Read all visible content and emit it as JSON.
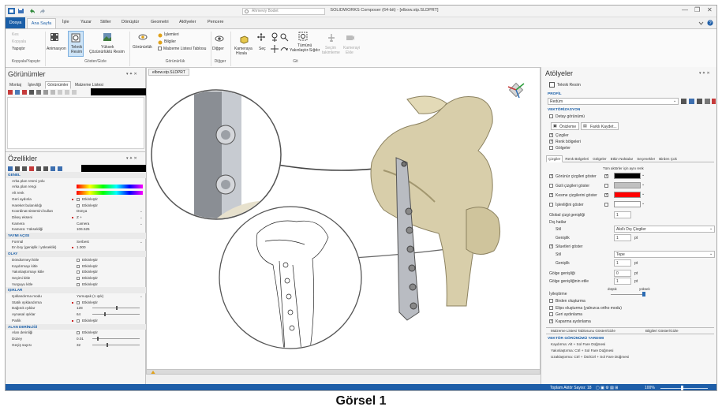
{
  "window": {
    "title": "SOLIDWORKS Composer (64-bit) - [elbow.stp.SLDPRT]",
    "search_placeholder": "Ahmeviy Bodet",
    "minimize": "—",
    "restore": "❐",
    "close": "✕"
  },
  "menu": {
    "file": "Dosya",
    "tabs": [
      "Ana Sayfa",
      "İşle",
      "Yazar",
      "Stiller",
      "Dönüştür",
      "Geometri",
      "Atölyeler",
      "Pencere"
    ],
    "active_tab": "Ana Sayfa"
  },
  "ribbon": {
    "clipboard": {
      "cut": "Kes",
      "copy": "Kopyala",
      "paste": "Yapıştır",
      "group": "Kopyala/Yapıştır"
    },
    "view": {
      "animation": "Animasyon",
      "technical": "Teknik",
      "technical2": "Resim",
      "hires": "Yüksek",
      "hires2": "Çözünürlüklü Resim",
      "group": "Göster/Gizle"
    },
    "visibility": {
      "show": "Görünürlük",
      "markers": "İşlemleri",
      "info": "Bilgiler",
      "bom_table": "Malzeme Listesi Tablosu",
      "group": "Görünürlük"
    },
    "other": {
      "label": "Diğger",
      "group": "Diğger"
    },
    "camera": {
      "camera": "Kameraya",
      "align": "Hizala",
      "select": "Seç",
      "fit": "Tümünü",
      "fit2": "Yakınlaştır-Sığdır",
      "group": "Git"
    },
    "flight": {
      "label": "Seçim",
      "label2": "takimleme",
      "label3": "Kamerayi",
      "label4": "Ekle"
    }
  },
  "left_top": {
    "title": "Görünümler",
    "tabs": [
      "Montaj",
      "İşlevliği",
      "Görünümler",
      "Malzeme Listesi"
    ],
    "active_tab": "Görünümler"
  },
  "properties": {
    "title": "Özellikler",
    "rows": [
      {
        "type": "section",
        "label": "GENEL"
      },
      {
        "label": "Arka plan resmi yolu",
        "value": ""
      },
      {
        "label": "Arka plan rengi",
        "value": "",
        "gradient": true
      },
      {
        "label": "Alt renk",
        "value": "",
        "gradient": true
      },
      {
        "label": "Geri aydınla",
        "value": "Etkinleştir",
        "check": true,
        "dot": true
      },
      {
        "label": "Hareket bulanıklığı",
        "value": "Etkinleştir",
        "check": true
      },
      {
        "label": "Koordinat sistemini kullan",
        "value": "Dünya",
        "dropdown": true
      },
      {
        "label": "Dikey ekseni",
        "value": "Z +",
        "dropdown": true,
        "dot": true
      },
      {
        "label": "Kamera",
        "value": "Camera",
        "dropdown": true
      },
      {
        "label": "Kamera: Yüksekliği",
        "value": "106.525"
      },
      {
        "type": "section",
        "label": "YAYMI AÇISI"
      },
      {
        "label": "Formül",
        "value": "Serbest",
        "dropdown": true
      },
      {
        "label": "En boy (genişlik / yükseklik)",
        "value": "1.000",
        "dot": true
      },
      {
        "type": "section",
        "label": "OLAY"
      },
      {
        "label": "Döndürmeyi kitle",
        "value": "Etkinleştir",
        "check": true
      },
      {
        "label": "Kaydırmayı kitle",
        "value": "Etkinleştir",
        "check": true
      },
      {
        "label": "Yakınlaştırmayı kitle",
        "value": "Etkinleştir",
        "check": true
      },
      {
        "label": "Seçimi kitle",
        "value": "Etkinleştir",
        "check": true
      },
      {
        "label": "Vurguyu kitle",
        "value": "Etkinleştir",
        "check": true
      },
      {
        "type": "section",
        "label": "IŞIKLAR"
      },
      {
        "label": "Işıklandırma modu",
        "value": "Yumuşak (1 ışık)",
        "dropdown": true
      },
      {
        "label": "Statik ışıklandırma",
        "value": "Etkinleştir",
        "check": true,
        "dot": true
      },
      {
        "label": "Dağınık ışıklar",
        "value": "128",
        "slider": 0.5
      },
      {
        "label": "Aynasal ışıklar",
        "value": "64",
        "slider": 0.25
      },
      {
        "label": "Parlik",
        "value": "Etkinleştir",
        "check": true,
        "dot": true
      },
      {
        "type": "section",
        "label": "ALAN DERİNLİĞİ"
      },
      {
        "label": "Alan derinliği",
        "value": "Etkinleştir",
        "check": true
      },
      {
        "label": "Düzey",
        "value": "0.01",
        "slider": 0.1
      },
      {
        "label": "Geçiş sayısı",
        "value": "32",
        "slider": 0.3
      }
    ]
  },
  "viewport": {
    "tab": "elbow.stp.SLDPRT"
  },
  "workshop": {
    "title": "Atölyeler",
    "sub": "Teknik Resim",
    "profile_section": "PROFİL",
    "profile_value": "Redüm",
    "vectorize_section": "VEKTÖRİZASYON",
    "detail_view": "Detay görünümü",
    "preview": "Önizleme",
    "save_as": "Farklı Kaydet...",
    "lines": "Çizgiler",
    "color_areas": "Renk bölgeleri",
    "shadows": "Gölgeler",
    "tabs": [
      "Çizgiler",
      "Renk Bölgeleri",
      "Gölgeler",
      "Etkin Noktalar",
      "Seçenekler",
      "Birden Çok"
    ],
    "active_tab": "Çizgiler",
    "all_items_header": "Tüm aktörler için aynı renk",
    "line_rows": [
      {
        "label": "Görünür çizgileri göster",
        "color": "#000000",
        "checked": true
      },
      {
        "label": "Gizli çizgileri göster",
        "color": "#c0c0c0",
        "checked": false
      },
      {
        "label": "Kesme çizgilerini göster",
        "color": "#ff0000",
        "checked": true
      },
      {
        "label": "İşlevliğini göster",
        "color": "#ffffff",
        "checked": false
      }
    ],
    "global_width_label": "Global çizgi genişliği",
    "global_width_value": "1",
    "outlines": "Dış hatlar",
    "style_label": "Stil",
    "style_value": "Akıllı Dış Çizgiler",
    "width_label": "Genişlik",
    "width_value": "1",
    "width_unit": "pt",
    "silhouette": "Siluetleri göster",
    "style2_value": "Tepe",
    "width2_value": "1",
    "shadow_width_label": "Gölge genişliği",
    "shadow_width_value": "0",
    "shadow_angle_label": "Gölge genişliğinin etile",
    "shadow_angle_value": "1",
    "low": "düşük",
    "high": "yüksek",
    "smoothing": "İyileştirme",
    "opts": [
      {
        "label": "Birden oluşturma",
        "checked": false
      },
      {
        "label": "Elips oluşturma (yalnızca ortho modu)",
        "checked": false
      },
      {
        "label": "Geri aydınlama",
        "checked": false
      },
      {
        "label": "Kaparma aydınlama",
        "checked": true
      }
    ],
    "bottom_tab_1": "Malzeme Listesi Tablosunu Göster/Gizle",
    "bottom_tab_2": "Bilgileri Göster/Gizle",
    "help_title": "VEKTÖR GÖRÜNÜMÜ YARDIMI",
    "help_lines": [
      "Kaydırma: Alt + Sol Fare Düğmesi",
      "Yakınlaştırma: Ctrl + Sol Fare Düğmesi",
      "Uzaklaştırma: Ctrl + Üst/Ctrl + Sol Fare Düğmesi"
    ]
  },
  "status": {
    "text": "Toplam Aktör Sayısı: 18",
    "zoom": "100%"
  },
  "caption": "Görsel 1"
}
